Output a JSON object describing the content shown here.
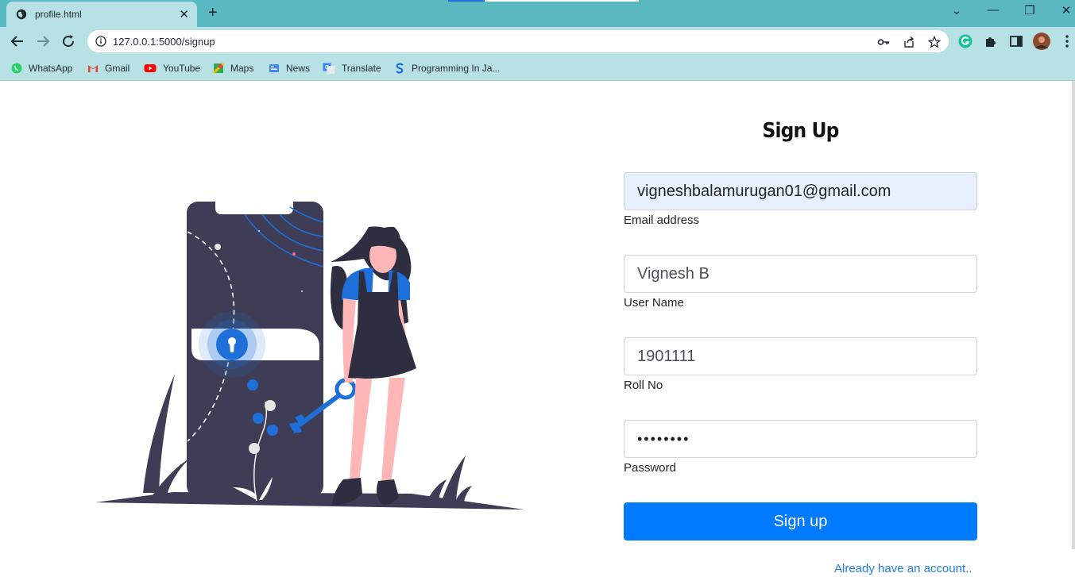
{
  "browser": {
    "tab_title": "profile.html",
    "tab_close": "✕",
    "new_tab": "+",
    "url": "127.0.0.1:5000/signup",
    "window_controls": {
      "dropdown": "⌄",
      "minimize": "—",
      "restore": "❐",
      "close": "✕"
    },
    "bookmarks": [
      {
        "label": "WhatsApp",
        "icon": "whatsapp-icon",
        "color": "#25d366"
      },
      {
        "label": "Gmail",
        "icon": "gmail-icon",
        "color": "#ea4335"
      },
      {
        "label": "YouTube",
        "icon": "youtube-icon",
        "color": "#ff0000"
      },
      {
        "label": "Maps",
        "icon": "maps-icon",
        "color": "#34a853"
      },
      {
        "label": "News",
        "icon": "news-icon",
        "color": "#4285f4"
      },
      {
        "label": "Translate",
        "icon": "translate-icon",
        "color": "#4285f4"
      },
      {
        "label": "Programming In Ja...",
        "icon": "s-icon",
        "color": "#1e6fd9"
      }
    ]
  },
  "form": {
    "title": "Sign Up",
    "email": {
      "value": "vigneshbalamurugan01@gmail.com",
      "label": "Email address"
    },
    "username": {
      "value": "Vignesh B",
      "label": "User Name"
    },
    "rollno": {
      "value": "1901111",
      "label": "Roll No"
    },
    "password": {
      "value": "••••••••",
      "label": "Password"
    },
    "submit_label": "Sign up",
    "login_link": "Already have an account.."
  },
  "colors": {
    "primary": "#007bff",
    "illustration_dark": "#3f3d56",
    "illustration_blue": "#1e6fd9",
    "skin": "#ffb6b6"
  }
}
